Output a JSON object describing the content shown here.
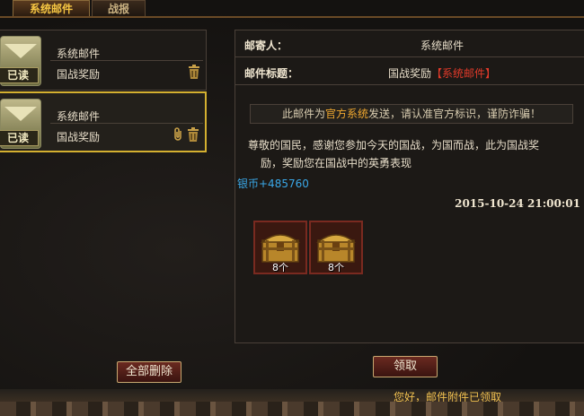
{
  "tabs": [
    {
      "label": "系统邮件",
      "active": true
    },
    {
      "label": "战报",
      "active": false
    }
  ],
  "mail_list": [
    {
      "badge": "已读",
      "sender": "系统邮件",
      "subject": "国战奖励",
      "has_attachment": false,
      "selected": false
    },
    {
      "badge": "已读",
      "sender": "系统邮件",
      "subject": "国战奖励",
      "has_attachment": true,
      "selected": true
    }
  ],
  "detail": {
    "sender_label": "邮寄人：",
    "sender_value": "系统邮件",
    "subject_label": "邮件标题：",
    "subject_value": "国战奖励",
    "subject_tag": "【系统邮件】",
    "notice_prefix": "此邮件为",
    "notice_highlight": "官方系统",
    "notice_suffix": "发送，请认准官方标识，谨防诈骗！",
    "body_line1": "尊敬的国民，感谢您参加今天的国战，为国而战，此为国战奖",
    "body_line2": "励，奖励您在国战中的英勇表现",
    "reward_text": "银币+485760",
    "timestamp": "2015-10-24 21:00:01",
    "attachments": [
      {
        "icon": "treasure-chest-icon",
        "count": "8个"
      },
      {
        "icon": "treasure-chest-icon",
        "count": "8个"
      }
    ]
  },
  "buttons": {
    "delete_all": "全部删除",
    "claim": "领取"
  },
  "status_text": "您好，邮件附件已领取",
  "colors": {
    "accent_gold": "#f5c542",
    "tag_red": "#e23a2a",
    "highlight_orange": "#f0a830",
    "reward_blue": "#3aa8e8"
  }
}
